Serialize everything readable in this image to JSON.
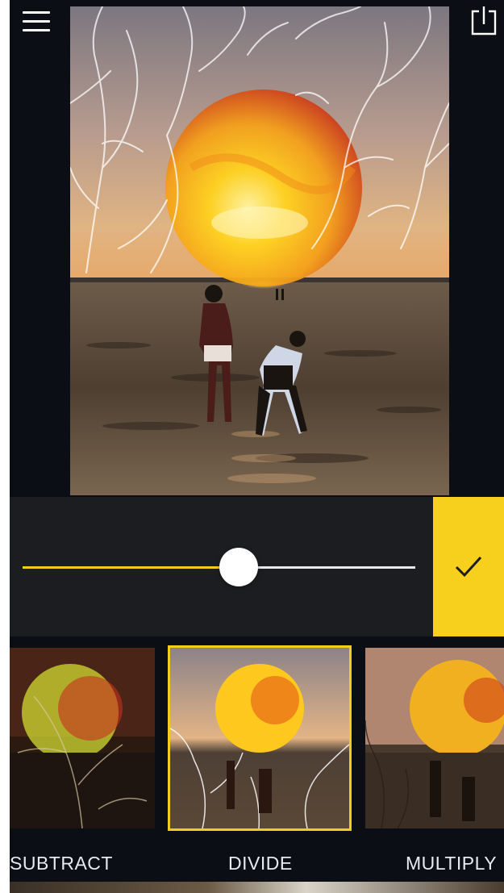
{
  "toolbar": {
    "menu_icon": "hamburger-menu-icon",
    "share_icon": "share-export-icon"
  },
  "editor": {
    "photo_description_icon": "photo-canvas",
    "blend_opacity": 0.55
  },
  "apply": {
    "icon": "checkmark-icon"
  },
  "colors": {
    "accent": "#f7cf1d",
    "panel": "#1c1d21",
    "background": "#0b0e15"
  },
  "blend_modes": [
    {
      "label": "SUBTRACT",
      "selected": false
    },
    {
      "label": "DIVIDE",
      "selected": true
    },
    {
      "label": "MULTIPLY",
      "selected": false
    }
  ]
}
